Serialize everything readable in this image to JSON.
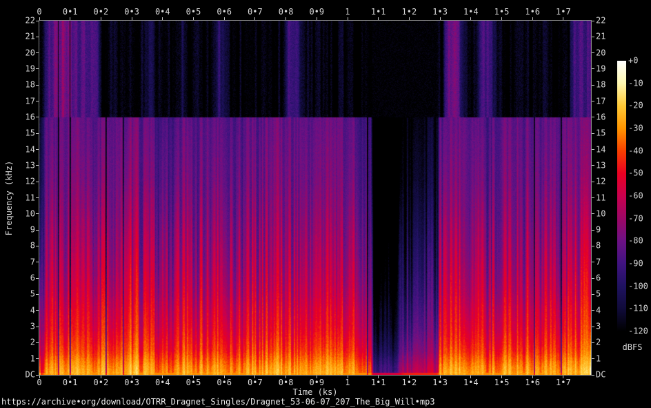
{
  "page": {
    "background": "#000000"
  },
  "footer": {
    "url": "https://archive•org/download/OTRR_Dragnet_Singles/Dragnet_53-06-07_207_The_Big_Will•mp3"
  },
  "chart_data": {
    "type": "heatmap",
    "subtype": "audio-spectrogram",
    "title": "",
    "xlabel": "Time (ks)",
    "ylabel": "Frequency (kHz)",
    "x_ticks": [
      "0",
      "0•1",
      "0•2",
      "0•3",
      "0•4",
      "0•5",
      "0•6",
      "0•7",
      "0•8",
      "0•9",
      "1",
      "1•1",
      "1•2",
      "1•3",
      "1•4",
      "1•5",
      "1•6",
      "1•7"
    ],
    "x_range_ks": [
      0,
      1.79
    ],
    "y_ticks_top_to_bottom": [
      "22",
      "21",
      "20",
      "19",
      "18",
      "17",
      "16",
      "15",
      "14",
      "13",
      "12",
      "11",
      "10",
      "9",
      "8",
      "7",
      "6",
      "5",
      "4",
      "3",
      "2",
      "1",
      "DC"
    ],
    "y_range_khz": [
      0,
      22
    ],
    "grid": false,
    "colorbar": {
      "label": "dBFS",
      "ticks": [
        "+0",
        "-10",
        "-20",
        "-30",
        "-40",
        "-50",
        "-60",
        "-70",
        "-80",
        "-90",
        "-100",
        "-110",
        "-120"
      ],
      "range_dbfs": [
        0,
        -120
      ],
      "palette_stops_dbfs_hex": [
        [
          0,
          "#ffffff"
        ],
        [
          -10,
          "#fff7b0"
        ],
        [
          -20,
          "#ffc937"
        ],
        [
          -30,
          "#ff9500"
        ],
        [
          -40,
          "#f74000"
        ],
        [
          -50,
          "#ea0022"
        ],
        [
          -60,
          "#c9004e"
        ],
        [
          -70,
          "#9c0766"
        ],
        [
          -80,
          "#6c1184"
        ],
        [
          -90,
          "#401380"
        ],
        [
          -100,
          "#1f1260"
        ],
        [
          -110,
          "#100b3a"
        ],
        [
          -120,
          "#000000"
        ]
      ]
    },
    "content": {
      "mp3_lowpass_cutoff_khz": 16,
      "above_cutoff_dbfs_range": [
        -120,
        -70
      ],
      "freq_profile_dbfs": [
        [
          0,
          -27
        ],
        [
          0.15,
          -25
        ],
        [
          0.5,
          -28
        ],
        [
          1.0,
          -34
        ],
        [
          1.5,
          -40
        ],
        [
          2.2,
          -45
        ],
        [
          3,
          -50
        ],
        [
          4,
          -54
        ],
        [
          5,
          -59
        ],
        [
          6.5,
          -64
        ],
        [
          8,
          -68
        ],
        [
          10,
          -73
        ],
        [
          12,
          -77
        ],
        [
          14,
          -79
        ],
        [
          16,
          -81
        ]
      ]
    }
  }
}
